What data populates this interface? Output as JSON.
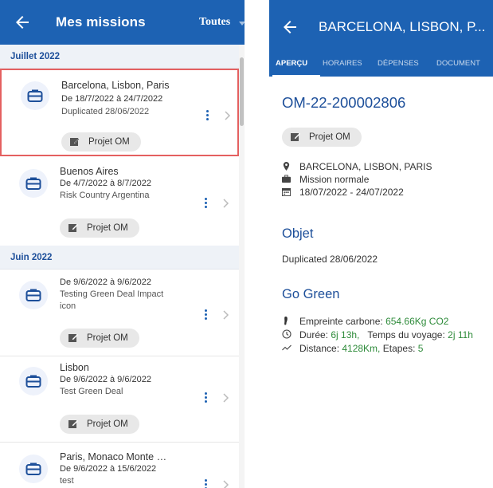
{
  "left": {
    "title": "Mes missions",
    "filter": "Toutes",
    "sections": [
      {
        "label": "Juillet 2022"
      },
      {
        "label": "Juin 2022"
      }
    ],
    "missions": [
      {
        "title": "Barcelona, Lisbon, Paris",
        "dates": "De 18/7/2022 à 24/7/2022",
        "note": "Duplicated 28/06/2022",
        "chip": "Projet OM"
      },
      {
        "title": "Buenos Aires",
        "dates": "De 4/7/2022 à 8/7/2022",
        "note": "Risk Country Argentina",
        "chip": "Projet OM"
      },
      {
        "title": "De 9/6/2022 à 9/6/2022",
        "dates": "Testing Green Deal Impact",
        "note": "icon",
        "chip": "Projet OM"
      },
      {
        "title": "Lisbon",
        "dates": "De 9/6/2022 à 9/6/2022",
        "note": "Test Green Deal",
        "chip": "Projet OM"
      },
      {
        "title": "Paris, Monaco Monte …",
        "dates": "De 9/6/2022 à 15/6/2022",
        "note": "test",
        "chip": ""
      }
    ]
  },
  "right": {
    "title": "BARCELONA, LISBON, P...",
    "tabs": [
      "APERÇU",
      "HORAIRES",
      "DÉPENSES",
      "DOCUMENT"
    ],
    "om_number": "OM-22-200002806",
    "chip": "Projet OM",
    "destinations": "BARCELONA, LISBON, PARIS",
    "mission_type": "Mission normale",
    "period": "18/07/2022 - 24/07/2022",
    "objet_heading": "Objet",
    "objet_text": "Duplicated 28/06/2022",
    "gogreen_heading": "Go Green",
    "carbon_label": "Empreinte carbone: ",
    "carbon_value": "654.66Kg CO2",
    "duration_label": "Durée: ",
    "duration_value": "6j 13h,",
    "travel_label": "Temps du voyage: ",
    "travel_value": "2j 11h",
    "distance_label": "Distance: ",
    "distance_value": "4128Km,",
    "steps_label": "Etapes: ",
    "steps_value": "5"
  },
  "colors": {
    "primary": "#1d62b3",
    "heading": "#1d4f9a",
    "highlight": "#e46060",
    "green": "#2e8b3a"
  }
}
